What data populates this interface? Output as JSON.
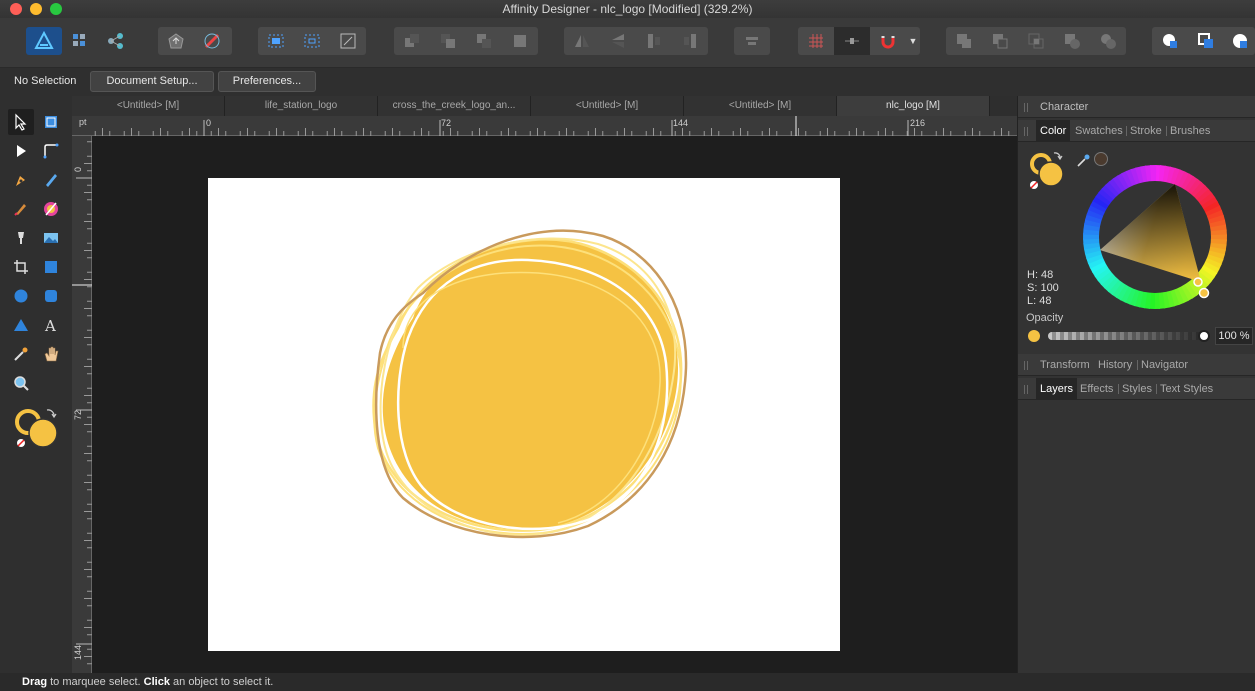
{
  "window": {
    "title": "Affinity Designer - nlc_logo [Modified] (329.2%)",
    "traffic_lights": {
      "close": "#fe5f57",
      "minimize": "#febc2e",
      "zoom": "#28c840"
    }
  },
  "context_bar": {
    "selection_label": "No Selection",
    "document_setup": "Document Setup...",
    "preferences": "Preferences..."
  },
  "document_tabs": [
    {
      "label": "<Untitled> [M]",
      "active": false
    },
    {
      "label": "life_station_logo",
      "active": false
    },
    {
      "label": "cross_the_creek_logo_an...",
      "active": false
    },
    {
      "label": "<Untitled> [M]",
      "active": false
    },
    {
      "label": "<Untitled> [M]",
      "active": false
    },
    {
      "label": "nlc_logo [M]",
      "active": true
    }
  ],
  "rulers": {
    "unit": "pt",
    "horizontal_ticks": [
      "0",
      "72",
      "144",
      "216"
    ],
    "vertical_ticks": [
      "0",
      "72",
      "144"
    ]
  },
  "panels": {
    "character": "Character",
    "color_tabs": [
      "Color",
      "Swatches",
      "Stroke",
      "Brushes"
    ],
    "active_color_tab": "Color",
    "hsl": {
      "h": "H: 48",
      "s": "S: 100",
      "l": "L: 48"
    },
    "opacity_label": "Opacity",
    "opacity_value": "100 %",
    "studio_tabs": [
      "Transform",
      "History",
      "Navigator"
    ],
    "layers_tabs": [
      "Layers",
      "Effects",
      "Styles",
      "Text Styles"
    ],
    "active_layers_tab": "Layers"
  },
  "colors": {
    "fill": "#f5c243",
    "stroke_light": "#fde07a",
    "stroke_dark": "#c99a5c",
    "accent": "#ffffff"
  },
  "status": {
    "drag": "Drag",
    "drag_rest": " to marquee select. ",
    "click": "Click",
    "click_rest": " an object to select it."
  }
}
